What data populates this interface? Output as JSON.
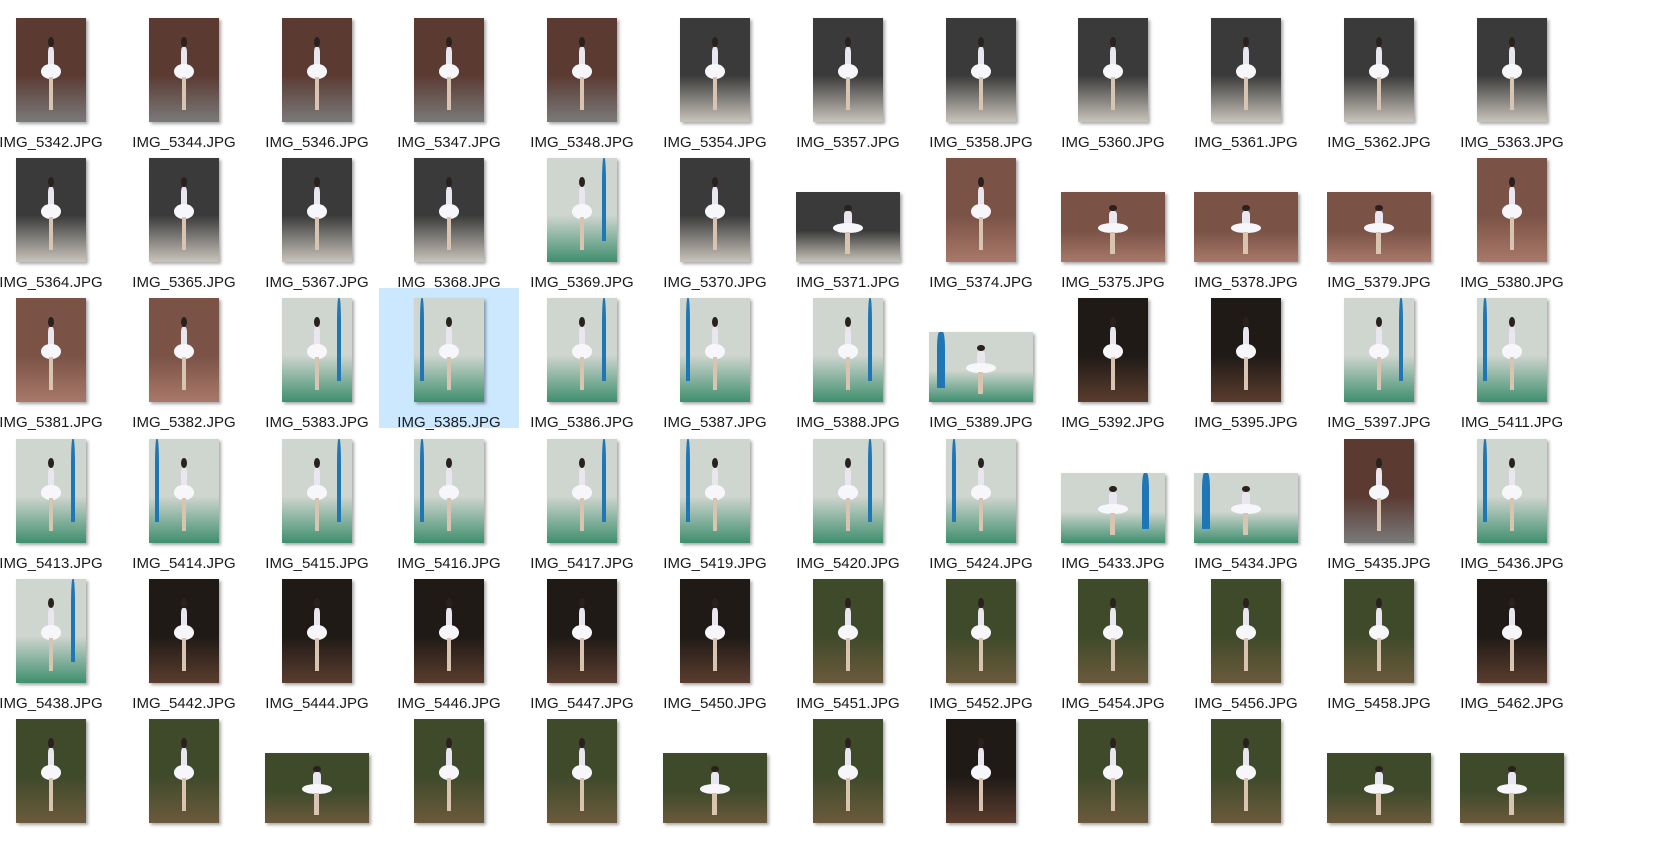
{
  "files": [
    {
      "name": "IMG_5342.JPG",
      "scene": "building",
      "orient": "portrait"
    },
    {
      "name": "IMG_5344.JPG",
      "scene": "building",
      "orient": "portrait"
    },
    {
      "name": "IMG_5346.JPG",
      "scene": "building",
      "orient": "portrait"
    },
    {
      "name": "IMG_5347.JPG",
      "scene": "building",
      "orient": "portrait"
    },
    {
      "name": "IMG_5348.JPG",
      "scene": "building",
      "orient": "portrait"
    },
    {
      "name": "IMG_5354.JPG",
      "scene": "stairs",
      "orient": "portrait"
    },
    {
      "name": "IMG_5357.JPG",
      "scene": "stairs",
      "orient": "portrait"
    },
    {
      "name": "IMG_5358.JPG",
      "scene": "stairs",
      "orient": "portrait"
    },
    {
      "name": "IMG_5360.JPG",
      "scene": "stairs",
      "orient": "portrait"
    },
    {
      "name": "IMG_5361.JPG",
      "scene": "stairs",
      "orient": "portrait"
    },
    {
      "name": "IMG_5362.JPG",
      "scene": "stairs",
      "orient": "portrait"
    },
    {
      "name": "IMG_5363.JPG",
      "scene": "stairs",
      "orient": "portrait"
    },
    {
      "name": "IMG_5364.JPG",
      "scene": "stairs",
      "orient": "portrait"
    },
    {
      "name": "IMG_5365.JPG",
      "scene": "stairs",
      "orient": "portrait"
    },
    {
      "name": "IMG_5367.JPG",
      "scene": "stairs",
      "orient": "portrait"
    },
    {
      "name": "IMG_5368.JPG",
      "scene": "stairs",
      "orient": "portrait"
    },
    {
      "name": "IMG_5369.JPG",
      "scene": "court",
      "orient": "portrait"
    },
    {
      "name": "IMG_5370.JPG",
      "scene": "stairs",
      "orient": "portrait"
    },
    {
      "name": "IMG_5371.JPG",
      "scene": "stairs",
      "orient": "landscape"
    },
    {
      "name": "IMG_5374.JPG",
      "scene": "brick",
      "orient": "portrait"
    },
    {
      "name": "IMG_5375.JPG",
      "scene": "brick",
      "orient": "landscape"
    },
    {
      "name": "IMG_5378.JPG",
      "scene": "brick",
      "orient": "landscape"
    },
    {
      "name": "IMG_5379.JPG",
      "scene": "brick",
      "orient": "landscape"
    },
    {
      "name": "IMG_5380.JPG",
      "scene": "brick",
      "orient": "portrait"
    },
    {
      "name": "IMG_5381.JPG",
      "scene": "brick",
      "orient": "portrait"
    },
    {
      "name": "IMG_5382.JPG",
      "scene": "brick",
      "orient": "portrait"
    },
    {
      "name": "IMG_5383.JPG",
      "scene": "court",
      "orient": "portrait"
    },
    {
      "name": "IMG_5385.JPG",
      "scene": "court",
      "orient": "portrait",
      "selected": true
    },
    {
      "name": "IMG_5386.JPG",
      "scene": "court",
      "orient": "portrait"
    },
    {
      "name": "IMG_5387.JPG",
      "scene": "court",
      "orient": "portrait"
    },
    {
      "name": "IMG_5388.JPG",
      "scene": "court",
      "orient": "portrait"
    },
    {
      "name": "IMG_5389.JPG",
      "scene": "court",
      "orient": "landscape"
    },
    {
      "name": "IMG_5392.JPG",
      "scene": "dark",
      "orient": "portrait"
    },
    {
      "name": "IMG_5395.JPG",
      "scene": "dark",
      "orient": "portrait"
    },
    {
      "name": "IMG_5397.JPG",
      "scene": "court",
      "orient": "portrait"
    },
    {
      "name": "IMG_5411.JPG",
      "scene": "court",
      "orient": "portrait"
    },
    {
      "name": "IMG_5413.JPG",
      "scene": "court",
      "orient": "portrait"
    },
    {
      "name": "IMG_5414.JPG",
      "scene": "court",
      "orient": "portrait"
    },
    {
      "name": "IMG_5415.JPG",
      "scene": "court",
      "orient": "portrait"
    },
    {
      "name": "IMG_5416.JPG",
      "scene": "court",
      "orient": "portrait"
    },
    {
      "name": "IMG_5417.JPG",
      "scene": "court",
      "orient": "portrait"
    },
    {
      "name": "IMG_5419.JPG",
      "scene": "court",
      "orient": "portrait"
    },
    {
      "name": "IMG_5420.JPG",
      "scene": "court",
      "orient": "portrait"
    },
    {
      "name": "IMG_5424.JPG",
      "scene": "court",
      "orient": "portrait"
    },
    {
      "name": "IMG_5433.JPG",
      "scene": "court",
      "orient": "landscape"
    },
    {
      "name": "IMG_5434.JPG",
      "scene": "court",
      "orient": "landscape"
    },
    {
      "name": "IMG_5435.JPG",
      "scene": "building",
      "orient": "portrait"
    },
    {
      "name": "IMG_5436.JPG",
      "scene": "court",
      "orient": "portrait"
    },
    {
      "name": "IMG_5438.JPG",
      "scene": "court",
      "orient": "portrait"
    },
    {
      "name": "IMG_5442.JPG",
      "scene": "dark",
      "orient": "portrait"
    },
    {
      "name": "IMG_5444.JPG",
      "scene": "dark",
      "orient": "portrait"
    },
    {
      "name": "IMG_5446.JPG",
      "scene": "dark",
      "orient": "portrait"
    },
    {
      "name": "IMG_5447.JPG",
      "scene": "dark",
      "orient": "portrait"
    },
    {
      "name": "IMG_5450.JPG",
      "scene": "dark",
      "orient": "portrait"
    },
    {
      "name": "IMG_5451.JPG",
      "scene": "forest",
      "orient": "portrait"
    },
    {
      "name": "IMG_5452.JPG",
      "scene": "forest",
      "orient": "portrait"
    },
    {
      "name": "IMG_5454.JPG",
      "scene": "forest",
      "orient": "portrait"
    },
    {
      "name": "IMG_5456.JPG",
      "scene": "forest",
      "orient": "portrait"
    },
    {
      "name": "IMG_5458.JPG",
      "scene": "forest",
      "orient": "portrait"
    },
    {
      "name": "IMG_5462.JPG",
      "scene": "dark",
      "orient": "portrait"
    },
    {
      "scene": "forest",
      "orient": "portrait"
    },
    {
      "scene": "forest",
      "orient": "portrait"
    },
    {
      "scene": "forest",
      "orient": "landscape"
    },
    {
      "scene": "forest",
      "orient": "portrait"
    },
    {
      "scene": "forest",
      "orient": "portrait"
    },
    {
      "scene": "forest",
      "orient": "landscape"
    },
    {
      "scene": "forest",
      "orient": "portrait"
    },
    {
      "scene": "dark",
      "orient": "portrait"
    },
    {
      "scene": "forest",
      "orient": "portrait"
    },
    {
      "scene": "forest",
      "orient": "portrait"
    },
    {
      "scene": "forest",
      "orient": "landscape"
    },
    {
      "scene": "forest",
      "orient": "landscape"
    }
  ],
  "scene_colors": {
    "building": [
      "#5b3a32",
      "#7a7a7a"
    ],
    "stairs": [
      "#3a3a3a",
      "#c9c4bb"
    ],
    "brick": [
      "#7a5246",
      "#a8796a"
    ],
    "court": [
      "#cfd6cf",
      "#3f8f6f"
    ],
    "dark": [
      "#1f1a16",
      "#5a3d2e"
    ],
    "forest": [
      "#3f4a2b",
      "#6b5a3c"
    ]
  },
  "selected_color": "#cce8ff"
}
